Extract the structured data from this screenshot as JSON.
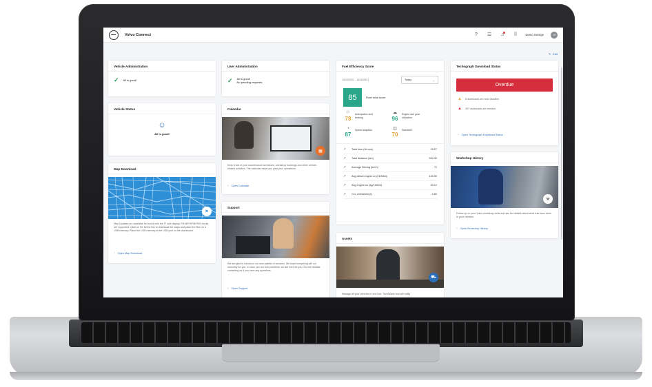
{
  "app": {
    "title": "Volvo Connect",
    "edit_label": "Edit"
  },
  "topbar": {
    "help_icon": "help-icon",
    "chat_icon": "chat-icon",
    "notification_icon": "bell-icon",
    "apps_icon": "grid-icon",
    "user_name": "Demo Sverige",
    "avatar_initials": "JR"
  },
  "vehicle_admin": {
    "title": "Vehicle Administration",
    "status": "All is good!"
  },
  "vehicle_status": {
    "title": "Vehicle Status",
    "status": "All is good!"
  },
  "map_download": {
    "title": "Map Download",
    "text": "Map Updates are available for trucks with the 9\" size display, FH16/FH/FM/FMX trucks are supported. Click on the below link to download the maps and place the files on a USB memory. Place the USB memory in the USB port on the dashboard.",
    "link": "Open Map Download"
  },
  "user_admin": {
    "title": "User Administration",
    "status": "All is good!",
    "sub_status": "No pending requests"
  },
  "calendar": {
    "title": "Calendar",
    "text": "Keep track of your maintenance schedules, workshop bookings and other vehicle-related activities. The calendar helps you plan your operations.",
    "link": "Open Calendar"
  },
  "support": {
    "title": "Support",
    "text": "We are glad to introduce our new palette of services. We hope everything will run smoothly for you. In case you run into problems, we are here for you. Do not hesitate contacting us if you have any questions.",
    "link": "Open Support"
  },
  "fuel": {
    "title": "Fuel Efficiency Score",
    "date_range": "14/10/2021 - 14/10/2021",
    "period": "Today",
    "total_score": "85",
    "total_label": "Fleet total score",
    "metrics": [
      {
        "label": "Anticipation and braking",
        "value": "78",
        "color": "#e8a23a",
        "icon": "flag-icon"
      },
      {
        "label": "Engine and gear utilization",
        "value": "96",
        "color": "#2aa78a",
        "icon": "engine-icon"
      },
      {
        "label": "Speed adaption",
        "value": "87",
        "color": "#2aa78a",
        "icon": "speedometer-icon"
      },
      {
        "label": "Standstill",
        "value": "70",
        "color": "#e8a23a",
        "icon": "standstill-icon"
      }
    ],
    "rows": [
      {
        "label": "Total time (hh:mm)",
        "value": "15:27"
      },
      {
        "label": "Total distance (km)",
        "value": "990.30"
      },
      {
        "label": "Average Driving (km/h)",
        "value": "72"
      },
      {
        "label": "Avg diesel engine on (l/100km)",
        "value": "133.30"
      },
      {
        "label": "Avg engine on (kg/100km)",
        "value": "33.10"
      },
      {
        "label": "CO₂ emissions (t)",
        "value": "0.50"
      }
    ]
  },
  "assets": {
    "title": "Assets",
    "text": "Manage all your vehicles in one tool. The Assets tool will notify"
  },
  "tachograph": {
    "title": "Techograph Download Status",
    "status_button": "Overdue",
    "warnings": [
      {
        "text": "8 downloads are near deadline.",
        "color": "#e8a23a"
      },
      {
        "text": "397 downloads are overdue.",
        "color": "#d72e3d"
      }
    ],
    "link": "Open Techograph Download Status"
  },
  "workshop": {
    "title": "Workshop History",
    "text": "Follow up on your Volvo workshop visits and see the details about what has been done to your vehicles.",
    "link": "Open Workshop History"
  }
}
